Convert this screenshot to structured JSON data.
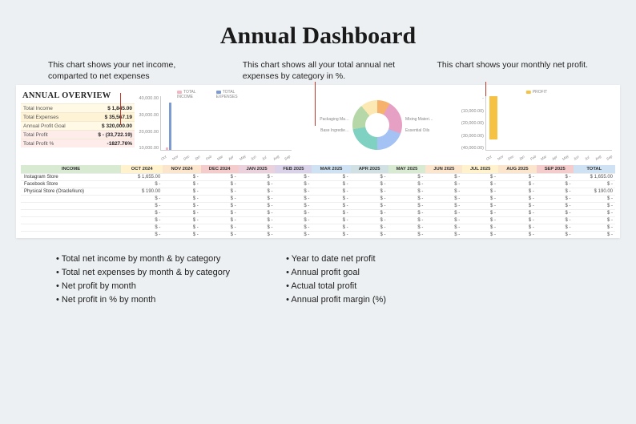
{
  "title": "Annual Dashboard",
  "annotations": {
    "left": "This chart shows your net income, comparted to net expenses",
    "middle": "This chart shows all your total annual net expenses by category in %.",
    "right": "This chart shows your monthly net profit."
  },
  "overview": {
    "heading": "ANNUAL OVERVIEW",
    "rows": [
      {
        "label": "Total Income",
        "value": "$        1,845.00"
      },
      {
        "label": "Total Expenses",
        "value": "$      35,567.19"
      },
      {
        "label": "Annual Profit Goal",
        "value": "$    320,000.00"
      },
      {
        "label": "Total Profit",
        "value": "$  - (33,722.19)"
      },
      {
        "label": "Total Profit %",
        "value": "-1827.76%"
      }
    ]
  },
  "chart_data": [
    {
      "type": "bar",
      "title": "",
      "series": [
        {
          "name": "TOTAL INCOME",
          "color": "#f4b6c2",
          "values": [
            1845,
            0,
            0,
            0,
            0,
            0,
            0,
            0,
            0,
            0,
            0,
            0
          ]
        },
        {
          "name": "TOTAL EXPENSES",
          "color": "#7e9bd1",
          "values": [
            35567,
            0,
            0,
            0,
            0,
            0,
            0,
            0,
            0,
            0,
            0,
            0
          ]
        }
      ],
      "categories": [
        "Oct",
        "Nov",
        "Dec",
        "Jan",
        "Feb",
        "Mar",
        "Apr",
        "May",
        "Jun",
        "Jul",
        "Aug",
        "Sep"
      ],
      "ylim": [
        0,
        40000
      ],
      "yticks": [
        "40,000.00",
        "30,000.00",
        "20,000.00",
        "10,000.00"
      ]
    },
    {
      "type": "pie",
      "title": "",
      "slices": [
        {
          "name": "Mixing Materi…"
        },
        {
          "name": "Packaging Ma…"
        },
        {
          "name": "Essential Oils"
        },
        {
          "name": "Base Ingredie…"
        }
      ]
    },
    {
      "type": "bar",
      "title": "",
      "series": [
        {
          "name": "PROFIT",
          "color": "#f6c243",
          "values": [
            -33722,
            0,
            0,
            0,
            0,
            0,
            0,
            0,
            0,
            0,
            0,
            0
          ]
        }
      ],
      "categories": [
        "Oct",
        "Nov",
        "Dec",
        "Jan",
        "Feb",
        "Mar",
        "Apr",
        "May",
        "Jun",
        "Jul",
        "Aug",
        "Sep"
      ],
      "yticks": [
        "-",
        "(10,000.00)",
        "(20,000.00)",
        "(30,000.00)",
        "(40,000.00)"
      ]
    }
  ],
  "table": {
    "income_header": "INCOME",
    "months": [
      "OCT 2024",
      "NOV 2024",
      "DEC 2024",
      "JAN 2025",
      "FEB 2025",
      "MAR 2025",
      "APR 2025",
      "MAY 2025",
      "JUN 2025",
      "JUL 2025",
      "AUG 2025",
      "SEP 2025"
    ],
    "total_header": "TOTAL",
    "rows": [
      {
        "label": "Instagram Store",
        "cells": [
          "$   1,655.00",
          "$      -",
          "$      -",
          "$      -",
          "$      -",
          "$      -",
          "$      -",
          "$      -",
          "$      -",
          "$      -",
          "$      -",
          "$      -"
        ],
        "total": "$   1,655.00"
      },
      {
        "label": "Facebook Store",
        "cells": [
          "$         -",
          "$      -",
          "$      -",
          "$      -",
          "$      -",
          "$      -",
          "$      -",
          "$      -",
          "$      -",
          "$      -",
          "$      -",
          "$      -"
        ],
        "total": "$         -"
      },
      {
        "label": "Physical Store (Oracle/kuro)",
        "cells": [
          "$     190.00",
          "$      -",
          "$      -",
          "$      -",
          "$      -",
          "$      -",
          "$      -",
          "$      -",
          "$      -",
          "$      -",
          "$      -",
          "$      -"
        ],
        "total": "$     190.00"
      },
      {
        "label": "",
        "cells": [
          "$      -",
          "$      -",
          "$      -",
          "$      -",
          "$      -",
          "$      -",
          "$      -",
          "$      -",
          "$      -",
          "$      -",
          "$      -",
          "$      -"
        ],
        "total": "$      -"
      },
      {
        "label": "",
        "cells": [
          "$      -",
          "$      -",
          "$      -",
          "$      -",
          "$      -",
          "$      -",
          "$      -",
          "$      -",
          "$      -",
          "$      -",
          "$      -",
          "$      -"
        ],
        "total": "$      -"
      },
      {
        "label": "",
        "cells": [
          "$      -",
          "$      -",
          "$      -",
          "$      -",
          "$      -",
          "$      -",
          "$      -",
          "$      -",
          "$      -",
          "$      -",
          "$      -",
          "$      -"
        ],
        "total": "$      -"
      },
      {
        "label": "",
        "cells": [
          "$      -",
          "$      -",
          "$      -",
          "$      -",
          "$      -",
          "$      -",
          "$      -",
          "$      -",
          "$      -",
          "$      -",
          "$      -",
          "$      -"
        ],
        "total": "$      -"
      },
      {
        "label": "",
        "cells": [
          "$      -",
          "$      -",
          "$      -",
          "$      -",
          "$      -",
          "$      -",
          "$      -",
          "$      -",
          "$      -",
          "$      -",
          "$      -",
          "$      -"
        ],
        "total": "$      -"
      },
      {
        "label": "",
        "cells": [
          "$      -",
          "$      -",
          "$      -",
          "$      -",
          "$      -",
          "$      -",
          "$      -",
          "$      -",
          "$      -",
          "$      -",
          "$      -",
          "$      -"
        ],
        "total": "$      -"
      }
    ]
  },
  "bullets": {
    "left": [
      "Total net income by month & by category",
      "Total net expenses by month & by category",
      "Net profit by month",
      "Net profit in % by month"
    ],
    "right": [
      "Year to date net profit",
      "Annual profit goal",
      "Actual total profit",
      "Annual profit margin (%)"
    ]
  }
}
